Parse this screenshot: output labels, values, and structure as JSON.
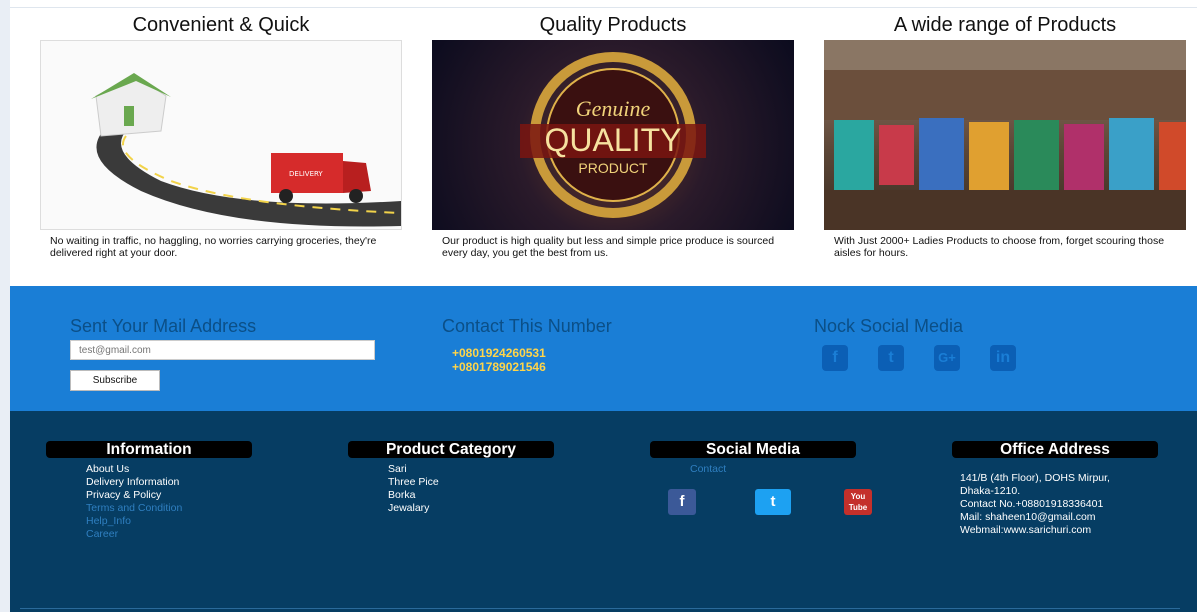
{
  "features": [
    {
      "title": "Convenient & Quick",
      "text": "No waiting in traffic, no haggling, no worries carrying groceries, they're delivered right at your door.",
      "image": "delivery-truck-illustration"
    },
    {
      "title": "Quality Products",
      "text": "Our product is high quality but less and simple price produce is sourced every day, you get the best from us.",
      "image": "genuine-quality-product-badge",
      "badge": {
        "line1": "Genuine",
        "line2": "QUALITY",
        "line3": "PRODUCT"
      }
    },
    {
      "title": "A wide range of Products",
      "text": "With Just 2000+ Ladies Products to choose from, forget scouring those aisles for hours.",
      "image": "store-shelves-photo"
    }
  ],
  "newsletter": {
    "title": "Sent Your Mail Address",
    "placeholder": "test@gmail.com",
    "button": "Subscribe"
  },
  "contact": {
    "title": "Contact This Number",
    "phones": [
      "+0801924260531",
      "+0801789021546"
    ]
  },
  "social_band": {
    "title": "Nock Social Media",
    "icons": [
      {
        "name": "facebook-icon",
        "glyph": "f"
      },
      {
        "name": "twitter-icon",
        "glyph": "t"
      },
      {
        "name": "google-plus-icon",
        "glyph": "G+"
      },
      {
        "name": "linkedin-icon",
        "glyph": "in"
      }
    ]
  },
  "footer": {
    "information": {
      "title": "Information",
      "links": [
        {
          "label": "About Us",
          "dim": false
        },
        {
          "label": "Delivery Information",
          "dim": false
        },
        {
          "label": "Privacy & Policy",
          "dim": false
        },
        {
          "label": "Terms and Condition",
          "dim": true
        },
        {
          "label": "Help_Info",
          "dim": true
        },
        {
          "label": "Career",
          "dim": true
        }
      ]
    },
    "category": {
      "title": "Product Category",
      "links": [
        "Sari",
        "Three Pice",
        "Borka",
        "Jewalary"
      ]
    },
    "social": {
      "title": "Social Media",
      "contact": "Contact",
      "icons": [
        {
          "name": "facebook-icon",
          "glyph": "f",
          "color": "#3b5998"
        },
        {
          "name": "twitter-icon",
          "glyph": "t",
          "color": "#1da1f2"
        },
        {
          "name": "youtube-icon",
          "glyph": "You Tube",
          "color": "#c4302b"
        }
      ]
    },
    "office": {
      "title": "Office Address",
      "lines": [
        "141/B (4th Floor), DOHS Mirpur,",
        "Dhaka-1210.",
        "Contact No.+08801918336401",
        "Mail: shaheen10@gmail.com",
        "Webmail:www.sarichuri.com"
      ]
    }
  },
  "colors": {
    "band": "#1a7ed6",
    "footer": "#063d63",
    "phone": "#ffd54a"
  }
}
